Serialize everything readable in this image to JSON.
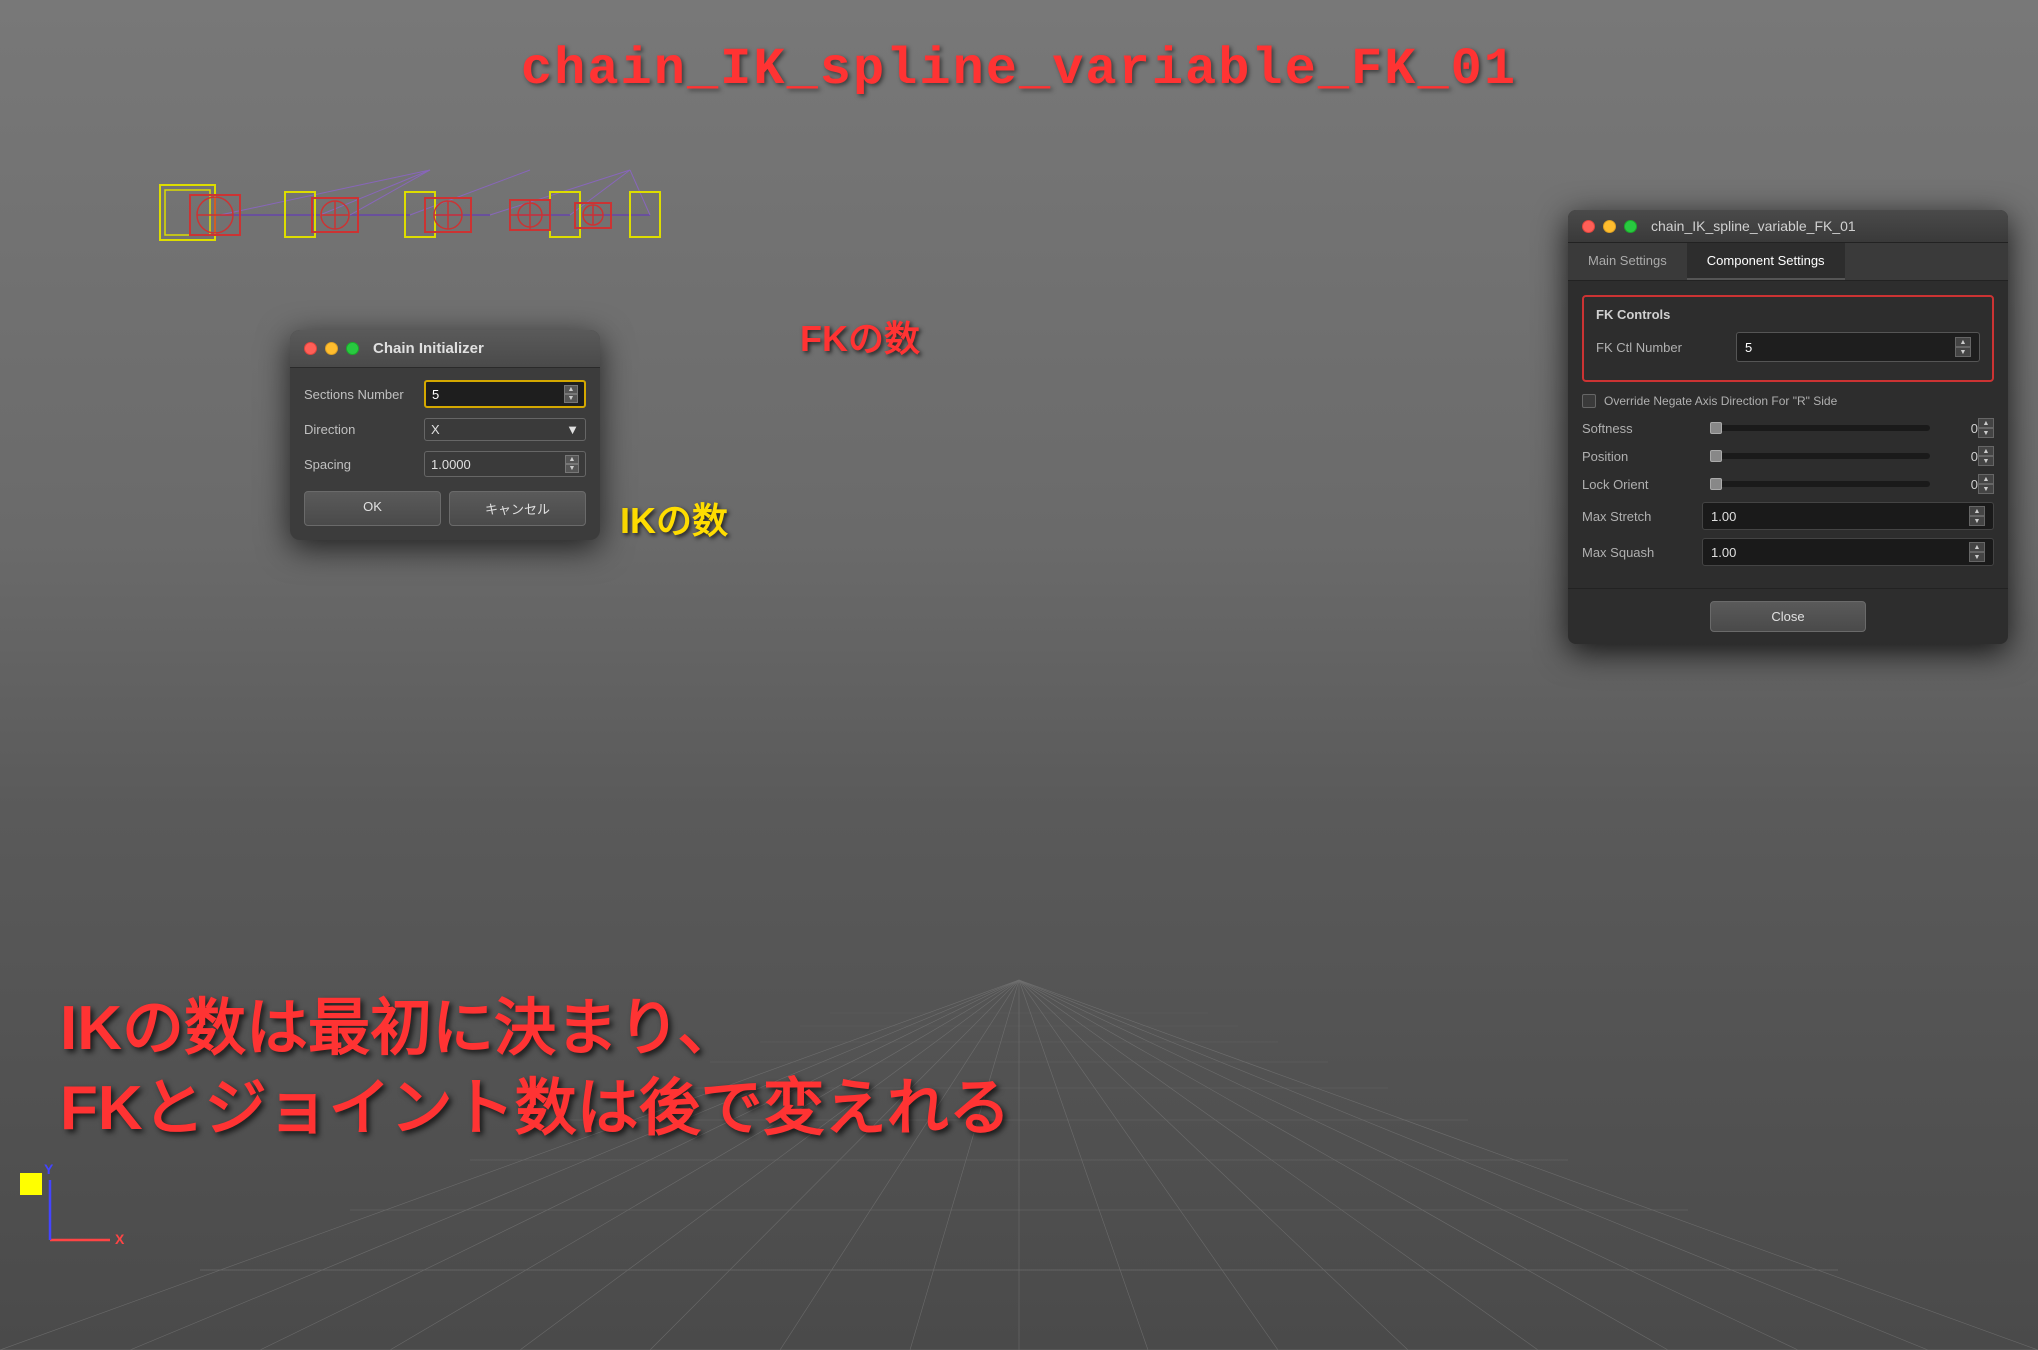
{
  "viewport": {
    "title": "chain_IK_spline_variable_FK_01",
    "background_color": "#6e7070"
  },
  "annotations": {
    "ik_label": "IKの数",
    "fk_label": "FKの数",
    "bottom_text_line1": "IKの数は最初に決まり、",
    "bottom_text_line2": "FKとジョイント数は後で変えれる"
  },
  "chain_dialog": {
    "title": "Chain Initializer",
    "traffic_lights": [
      "red",
      "yellow",
      "green"
    ],
    "fields": {
      "sections_number": {
        "label": "Sections Number",
        "value": "5"
      },
      "direction": {
        "label": "Direction",
        "value": "X"
      },
      "spacing": {
        "label": "Spacing",
        "value": "1.0000"
      }
    },
    "buttons": {
      "ok": "OK",
      "cancel": "キャンセル"
    }
  },
  "component_panel": {
    "title": "chain_IK_spline_variable_FK_01",
    "tabs": [
      "Main Settings",
      "Component Settings"
    ],
    "active_tab": "Component Settings",
    "fk_controls": {
      "section_title": "FK Controls",
      "fk_ctl_number": {
        "label": "FK Ctl Number",
        "value": "5"
      }
    },
    "checkbox": {
      "label": "Override Negate Axis Direction For \"R\" Side",
      "checked": false
    },
    "sliders": {
      "softness": {
        "label": "Softness",
        "value": "0",
        "percent": 0
      },
      "position": {
        "label": "Position",
        "value": "0",
        "percent": 0
      },
      "lock_orient": {
        "label": "Lock Orient",
        "value": "0",
        "percent": 0
      }
    },
    "max_stretch": {
      "label": "Max Stretch",
      "value": "1.00"
    },
    "max_squash": {
      "label": "Max Squash",
      "value": "1.00"
    },
    "close_button": "Close"
  }
}
